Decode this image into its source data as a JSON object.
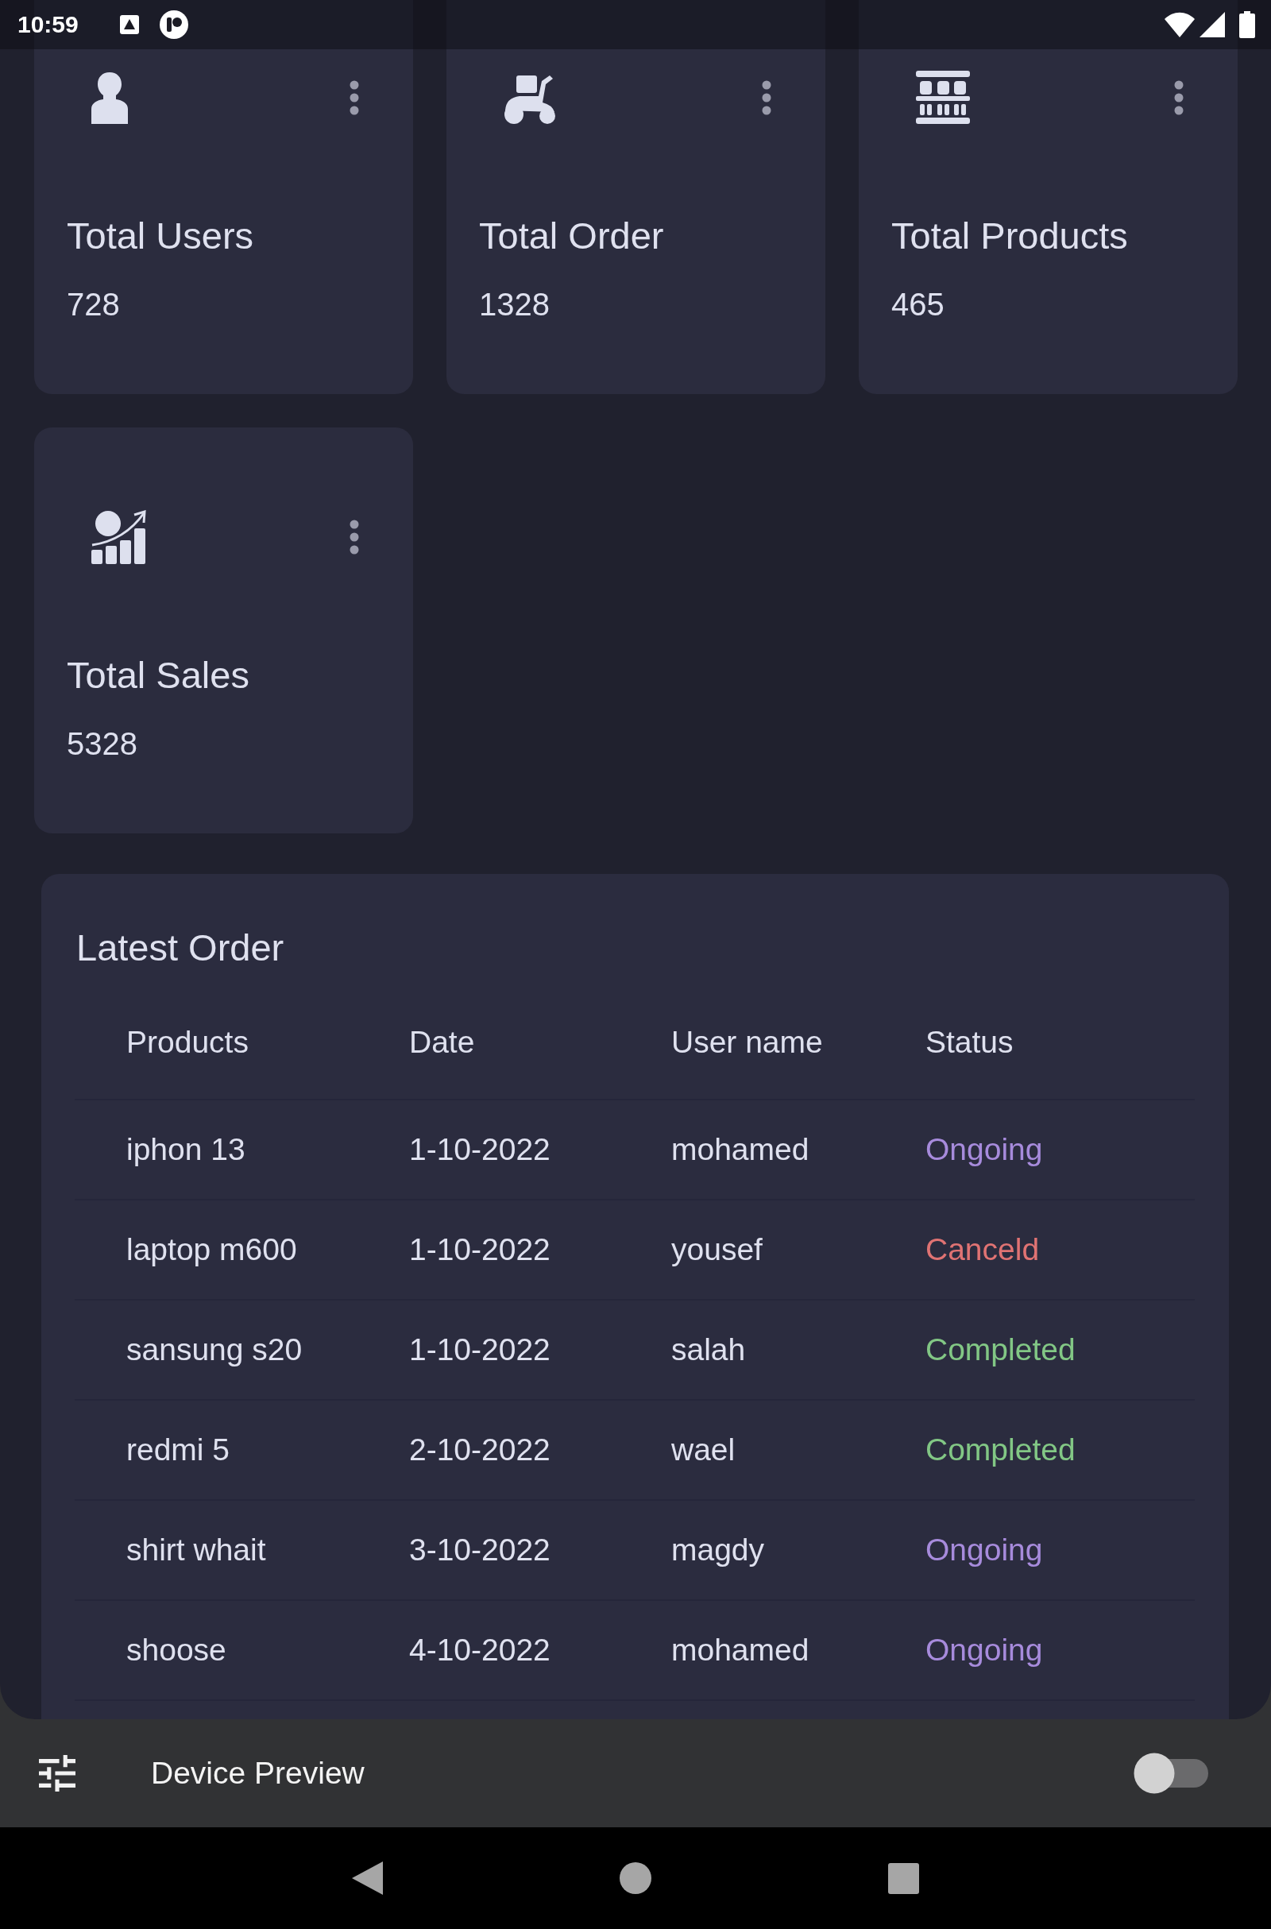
{
  "status_bar": {
    "time": "10:59"
  },
  "stat_cards": [
    {
      "kind": "users",
      "title": "Total Users",
      "value": "728"
    },
    {
      "kind": "orders",
      "title": "Total Order",
      "value": "1328"
    },
    {
      "kind": "products",
      "title": "Total Products",
      "value": "465"
    },
    {
      "kind": "sales",
      "title": "Total Sales",
      "value": "5328"
    }
  ],
  "latest_order": {
    "title": "Latest Order",
    "columns": [
      "Products",
      "Date",
      "User name",
      "Status"
    ],
    "rows": [
      {
        "product": "iphon 13",
        "date": "1-10-2022",
        "user_name": "mohamed",
        "status": {
          "label": "Ongoing",
          "color": "#a78bdc"
        }
      },
      {
        "product": "laptop m600",
        "date": "1-10-2022",
        "user_name": "yousef",
        "status": {
          "label": "Canceld",
          "color": "#e07373"
        }
      },
      {
        "product": "sansung s20",
        "date": "1-10-2022",
        "user_name": "salah",
        "status": {
          "label": "Completed",
          "color": "#82c785"
        }
      },
      {
        "product": "redmi 5",
        "date": "2-10-2022",
        "user_name": "wael",
        "status": {
          "label": "Completed",
          "color": "#82c785"
        }
      },
      {
        "product": "shirt whait",
        "date": "3-10-2022",
        "user_name": "magdy",
        "status": {
          "label": "Ongoing",
          "color": "#a78bdc"
        }
      },
      {
        "product": "shoose",
        "date": "4-10-2022",
        "user_name": "mohamed",
        "status": {
          "label": "Ongoing",
          "color": "#a78bdc"
        }
      }
    ]
  },
  "device_preview": {
    "label": "Device Preview",
    "on": false
  }
}
